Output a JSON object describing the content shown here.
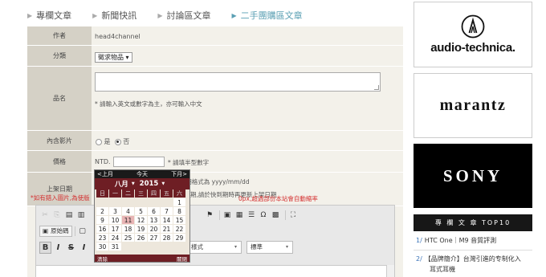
{
  "tabs": [
    {
      "label": "專欄文章",
      "active": false
    },
    {
      "label": "新聞快訊",
      "active": false
    },
    {
      "label": "討論區文章",
      "active": false
    },
    {
      "label": "二手團購區文章",
      "active": true
    }
  ],
  "form": {
    "author": {
      "label": "作者",
      "value": "head4channel"
    },
    "category": {
      "label": "分類",
      "value": "徵求物品",
      "arrow": "▾"
    },
    "product_name": {
      "label": "品名",
      "hint": "* 請輸入英文或數字為主，亦可輸入中文"
    },
    "video": {
      "label": "內含影片",
      "yes": "是",
      "no": "否",
      "selected": "否"
    },
    "price": {
      "label": "價格",
      "prefix": "NTD.",
      "hint": "* 請填半型數字"
    },
    "date": {
      "label": "上架日期",
      "hint1": "*日期格式為 yyyy/mm/dd",
      "hint2": "期,請於快到期時再更新上架日期"
    },
    "notice_left": "*如有錯入圖片,為使版",
    "notice_right": "0px,超過部份本站會自動縮率"
  },
  "editor": {
    "source_label": "原始碼",
    "style_label": "樣式",
    "format_label": "標準"
  },
  "calendar": {
    "prev": "<上月",
    "today": "今天",
    "next": "下月>",
    "month": "八月",
    "year": "2015",
    "weekdays": [
      "日",
      "一",
      "二",
      "三",
      "四",
      "五",
      "六"
    ],
    "days": [
      "",
      "",
      "",
      "",
      "",
      "",
      "1",
      "2",
      "3",
      "4",
      "5",
      "6",
      "7",
      "8",
      "9",
      "10",
      "11",
      "12",
      "13",
      "14",
      "15",
      "16",
      "17",
      "18",
      "19",
      "20",
      "21",
      "22",
      "23",
      "24",
      "25",
      "26",
      "27",
      "28",
      "29",
      "30",
      "31"
    ],
    "today_day": "11",
    "clear": "清除",
    "close": "關閉"
  },
  "sidebar": {
    "ads": [
      "audio-technica.",
      "marantz",
      "SONY"
    ],
    "top10_title": "專 欄 文 章 TOP10",
    "top10": [
      {
        "num": "1/",
        "title": "HTC One｜M9 音質評測"
      },
      {
        "num": "2/",
        "title": "【品牌簡介】台灣引進的专制化入",
        "title2": "耳式耳機"
      }
    ]
  },
  "colors": {
    "accent": "#5a9fb3",
    "calendar": "#6e1e24",
    "label_bg": "#d5d1c6",
    "form_bg": "#f3f1ea",
    "warning": "#d43030"
  }
}
